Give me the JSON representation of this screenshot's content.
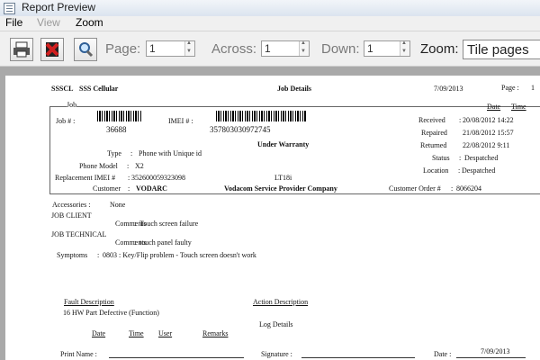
{
  "window": {
    "title": "Report Preview"
  },
  "menu": {
    "file": "File",
    "view": "View",
    "zoom": "Zoom"
  },
  "toolbar": {
    "print_icon": "printer-icon",
    "close_icon": "close-icon",
    "search_icon": "magnifier-icon",
    "page_label": "Page:",
    "page_value": "1",
    "across_label": "Across:",
    "across_value": "1",
    "down_label": "Down:",
    "down_value": "1",
    "zoom_label": "Zoom:",
    "zoom_value": "Tile pages"
  },
  "report": {
    "company_code": "SSSCL",
    "company_name": "SSS Cellular",
    "title": "Job Details",
    "date": "7/09/2013",
    "page_label": "Page :",
    "page_num": "1",
    "job_section": "Job",
    "job_label": "Job # :",
    "job_number": "36688",
    "imei_label": "IMEI # :",
    "imei": "357803030972745",
    "warranty": "Under Warranty",
    "type_label": "Type",
    "type_value": "Phone with Unique id",
    "model_label": "Phone Model",
    "model_value": "X2",
    "replacement_label": "Replacement IMEI #",
    "replacement_value": "352600059323098",
    "lt_value": "LT18i",
    "customer_label": "Customer",
    "customer_value": "VODARC",
    "provider": "Vodacom Service Provider Company",
    "date_header": "Date",
    "time_header": "Time",
    "received_label": "Received",
    "received_value": "20/08/2012 14:22",
    "repaired_label": "Repaired",
    "repaired_value": "21/08/2012 15:57",
    "returned_label": "Returned",
    "returned_value": "22/08/2012  9:11",
    "status_label": "Status",
    "status_value": "Despatched",
    "location_label": "Location",
    "location_value": "Despatched",
    "customer_order_label": "Customer Order #",
    "customer_order_value": "8066204",
    "accessories_label": "Accessories :",
    "accessories_value": "None",
    "job_client": "JOB CLIENT",
    "comments_label": "Comments",
    "client_comment": "Touch screen failure",
    "job_technical": "JOB TECHNICAL",
    "technical_comment": "touch panel faulty",
    "symptoms_label": "Symptoms",
    "symptoms_value": "0803 : Key/Flip problem - Touch screen doesn't work",
    "fault_header": "Fault Description",
    "action_header": "Action Description",
    "fault_value": "16 HW Part Defective (Function)",
    "log_details": "Log Details",
    "date_col": "Date",
    "time_col": "Time",
    "user_col": "User",
    "remarks_col": "Remarks",
    "print_name_label": "Print Name :",
    "signature_label": "Signature :",
    "date_label": "Date :",
    "signed_date": "7/09/2013"
  }
}
